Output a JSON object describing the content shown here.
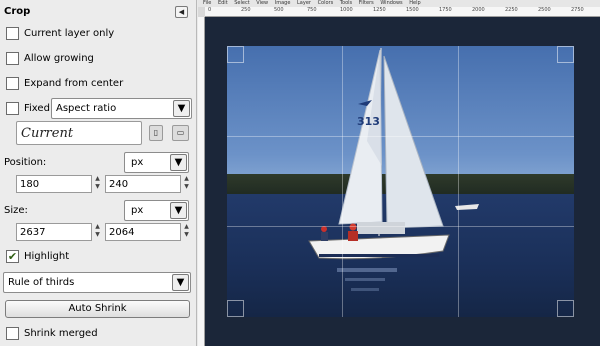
{
  "panel": {
    "title": "Crop",
    "current_layer_only": {
      "label": "Current layer only",
      "checked": false
    },
    "allow_growing": {
      "label": "Allow growing",
      "checked": false
    },
    "expand_from_center": {
      "label": "Expand from center",
      "checked": false
    },
    "fixed": {
      "label": "Fixed:",
      "checked": false,
      "mode": "Aspect ratio"
    },
    "current_text": "Current",
    "position": {
      "label": "Position:",
      "unit": "px",
      "x": "180",
      "y": "240"
    },
    "size": {
      "label": "Size:",
      "unit": "px",
      "w": "2637",
      "h": "2064"
    },
    "highlight": {
      "label": "Highlight",
      "checked": true
    },
    "guides": "Rule of thirds",
    "auto_shrink_label": "Auto Shrink",
    "shrink_merged": {
      "label": "Shrink merged",
      "checked": false
    }
  },
  "image_window": {
    "menu": [
      "File",
      "Edit",
      "Select",
      "View",
      "Image",
      "Layer",
      "Colors",
      "Tools",
      "Filters",
      "Windows",
      "Help"
    ],
    "ruler_marks": [
      "0",
      "250",
      "500",
      "750",
      "1000",
      "1250",
      "1500",
      "1750",
      "2000",
      "2250",
      "2500",
      "2750"
    ],
    "sail_number": "313"
  },
  "colors": {
    "highlight_check": "#2e5e12",
    "canvas_bg": "#1b2639"
  }
}
